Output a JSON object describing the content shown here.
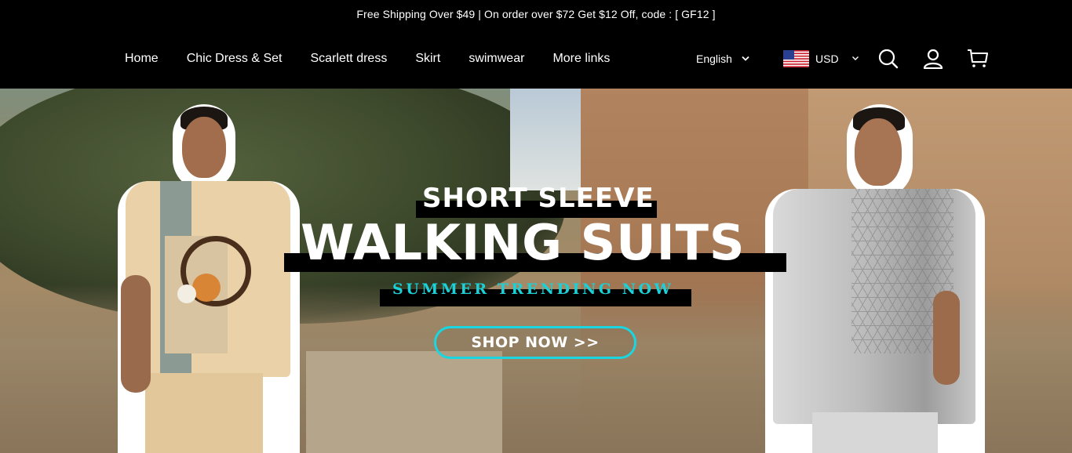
{
  "announcement": {
    "text": "Free Shipping Over $49 | On order over $72 Get $12 Off, code : [ GF12 ]"
  },
  "nav": {
    "items": [
      {
        "label": "Home"
      },
      {
        "label": "Chic Dress & Set"
      },
      {
        "label": "Scarlett dress"
      },
      {
        "label": "Skirt"
      },
      {
        "label": "swimwear"
      },
      {
        "label": "More links"
      }
    ]
  },
  "language": {
    "label": "English",
    "icon": "chevron-down-icon"
  },
  "currency": {
    "label": "USD",
    "flag": "us-flag-icon",
    "icon": "chevron-down-icon"
  },
  "header_icons": {
    "search": "search-icon",
    "account": "user-icon",
    "cart": "cart-icon"
  },
  "hero": {
    "line1": "SHORT SLEEVE",
    "line2": "WALKING SUITS",
    "line3": "SUMMER TRENDING NOW",
    "cta": "SHOP NOW >>",
    "accent_color": "#1ad6e0"
  }
}
